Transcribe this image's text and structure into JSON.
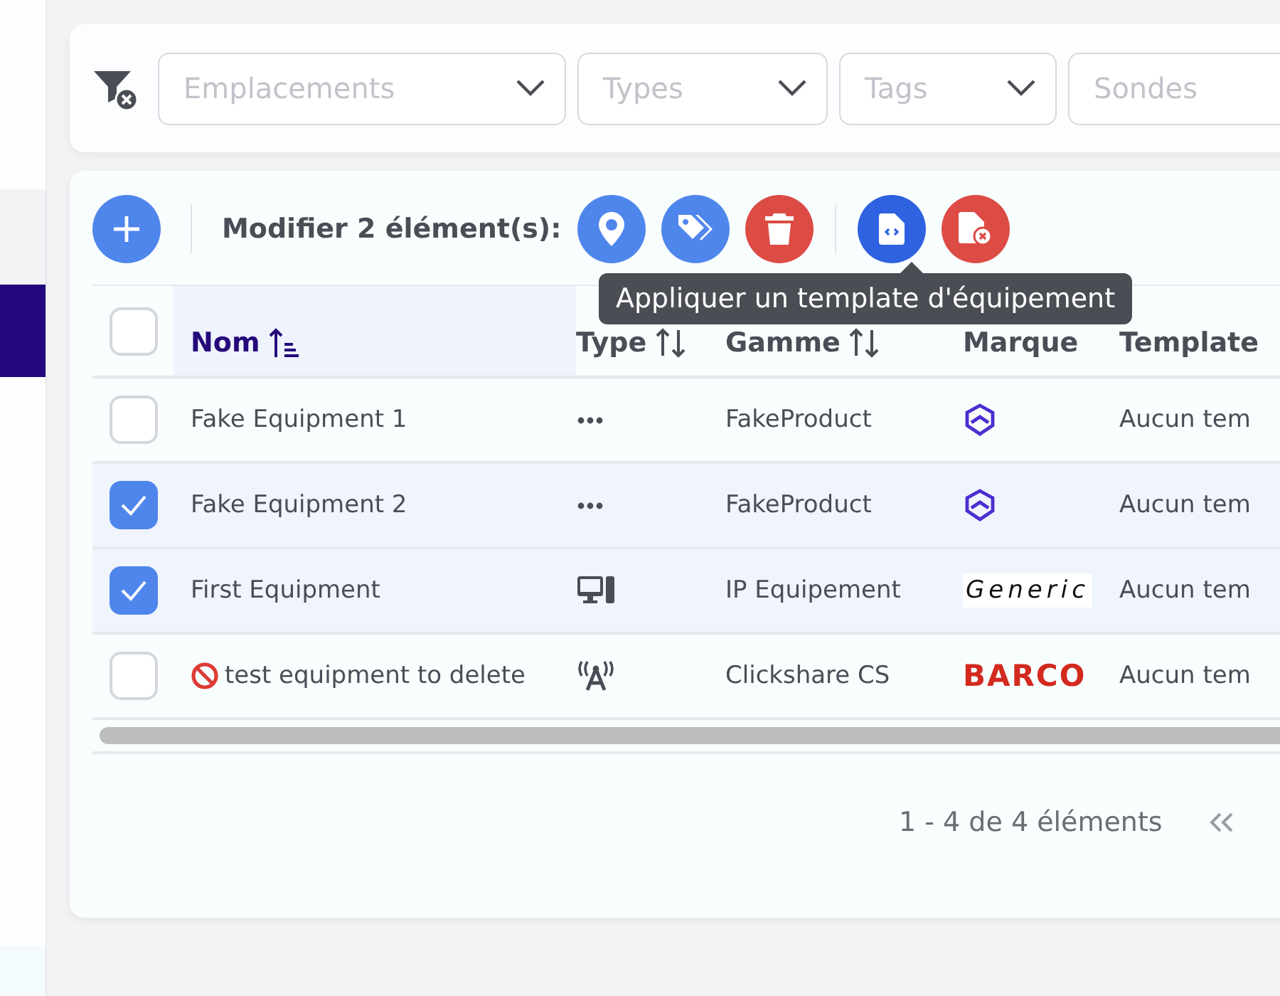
{
  "filters": {
    "dropdowns": [
      {
        "placeholder": "Emplacements"
      },
      {
        "placeholder": "Types"
      },
      {
        "placeholder": "Tags"
      },
      {
        "placeholder": "Sondes"
      }
    ]
  },
  "toolbar": {
    "selection_label": "Modifier 2 élément(s):",
    "actions": [
      {
        "kind": "location",
        "hovered": false,
        "group_start": false
      },
      {
        "kind": "tags",
        "hovered": false,
        "group_start": false
      },
      {
        "kind": "delete",
        "hovered": false,
        "group_start": false
      },
      {
        "kind": "apply-template",
        "hovered": true,
        "group_start": true
      },
      {
        "kind": "remove-template",
        "hovered": false,
        "group_start": false
      }
    ]
  },
  "tooltip": {
    "text": "Appliquer un template d'équipement"
  },
  "table": {
    "select_all": {
      "checked": false
    },
    "columns": [
      {
        "label": "Nom",
        "sortable": true,
        "sorted": true
      },
      {
        "label": "Type",
        "sortable": true,
        "sorted": false
      },
      {
        "label": "Gamme",
        "sortable": true,
        "sorted": false
      },
      {
        "label": "Marque",
        "sortable": false,
        "sorted": false
      },
      {
        "label": "Template",
        "sortable": false,
        "sorted": false
      }
    ],
    "rows": [
      {
        "checked": false,
        "deleted": false,
        "name": "Fake Equipment 1",
        "type": {
          "kind": "dots"
        },
        "range": "FakeProduct",
        "brand": {
          "kind": "mark"
        },
        "template": "Aucun tem"
      },
      {
        "checked": true,
        "deleted": false,
        "name": "Fake Equipment 2",
        "type": {
          "kind": "dots"
        },
        "range": "FakeProduct",
        "brand": {
          "kind": "mark"
        },
        "template": "Aucun tem"
      },
      {
        "checked": true,
        "deleted": false,
        "name": "First Equipment",
        "type": {
          "kind": "computer"
        },
        "range": "IP Equipement",
        "brand": {
          "kind": "script",
          "text": "Generic"
        },
        "template": "Aucun tem"
      },
      {
        "checked": false,
        "deleted": true,
        "name": "test equipment to delete",
        "type": {
          "kind": "antenna"
        },
        "range": "Clickshare CS",
        "brand": {
          "kind": "bold",
          "text": "BARCO"
        },
        "template": "Aucun tem"
      }
    ]
  },
  "pagination": {
    "range_text": "1 - 4 de 4 éléments"
  }
}
